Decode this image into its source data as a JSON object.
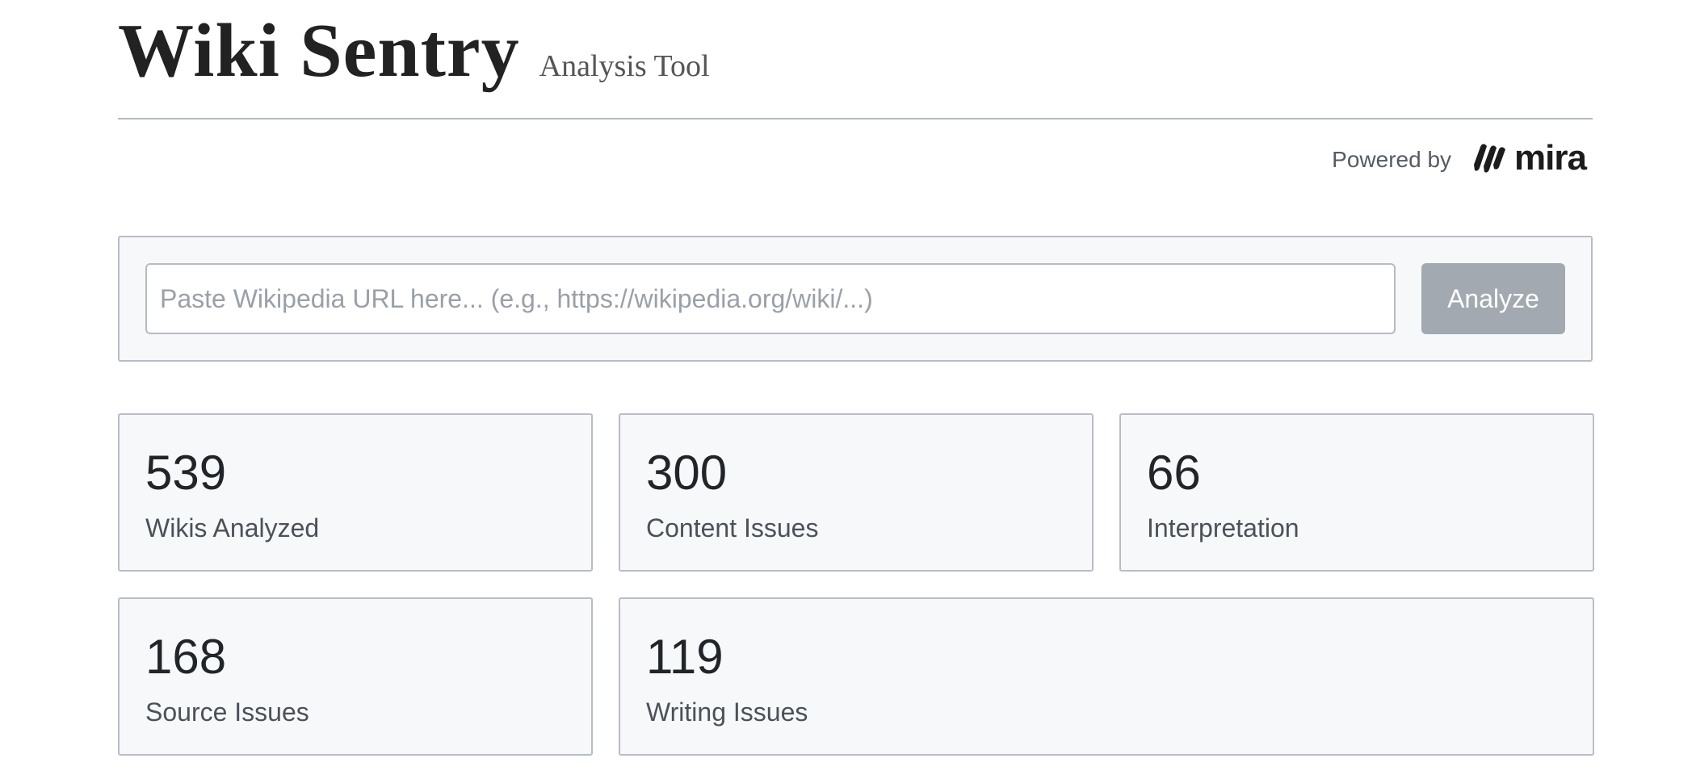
{
  "header": {
    "title": "Wiki Sentry",
    "subtitle": "Analysis Tool"
  },
  "powered_by": {
    "label": "Powered by",
    "brand": "mira",
    "brand_icon": "mira-logo-icon"
  },
  "search": {
    "placeholder": "Paste Wikipedia URL here... (e.g., https://wikipedia.org/wiki/...)",
    "value": "",
    "button_label": "Analyze"
  },
  "stats": [
    {
      "value": "539",
      "label": "Wikis Analyzed"
    },
    {
      "value": "300",
      "label": "Content Issues"
    },
    {
      "value": "66",
      "label": "Interpretation"
    },
    {
      "value": "168",
      "label": "Source Issues"
    },
    {
      "value": "119",
      "label": "Writing Issues"
    }
  ],
  "colors": {
    "panel_bg": "#f7f8fa",
    "border": "#b8bdc6",
    "button_disabled": "#a3a9b1",
    "text": "#212529"
  }
}
